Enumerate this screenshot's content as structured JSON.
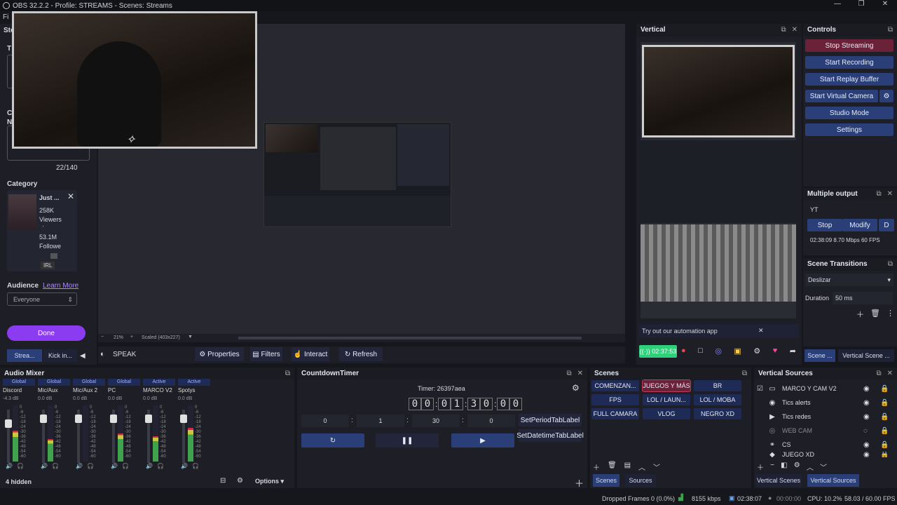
{
  "window": {
    "title": "OBS 32.2.2 - Profile: STREAMS - Scenes: Streams",
    "controls": [
      "—",
      "❐",
      "✕"
    ]
  },
  "menu": {
    "first": "Fi"
  },
  "stream_panel": {
    "title": "Ste",
    "section_t": "T",
    "section_c": "C",
    "section_n": "N",
    "char_count": "22/140",
    "category_label": "Category",
    "category": {
      "name": "Just ...",
      "viewers": "258K",
      "viewers_label": "Viewers",
      "followers": "53.1M",
      "followers_label": "Followe",
      "tag": "IRL",
      "dot": "·"
    },
    "audience_label": "Audience",
    "learn_more": "Learn More",
    "audience_value": "Everyone",
    "done": "Done",
    "tabs": [
      "Strea...",
      "Kick in..."
    ]
  },
  "preview": {
    "zoom": "21%",
    "scaled": "Scaled (403x227)",
    "zoom_minus": "−",
    "zoom_plus": "+"
  },
  "source_toolbar": {
    "source_name": "SPEAK",
    "properties": "Properties",
    "filters": "Filters",
    "interact": "Interact",
    "refresh": "Refresh"
  },
  "vertical": {
    "title": "Vertical",
    "automation_text": "Try out our automation app",
    "close_x": "✕",
    "rec_time": "02:37:53"
  },
  "controls": {
    "title": "Controls",
    "stop_streaming": "Stop Streaming",
    "start_recording": "Start Recording",
    "start_replay": "Start Replay Buffer",
    "start_virtual": "Start Virtual Camera",
    "studio_mode": "Studio Mode",
    "settings": "Settings"
  },
  "multiple_output": {
    "title": "Multiple output",
    "name": "YT",
    "stop": "Stop",
    "modify": "Modify",
    "extra": "D",
    "stats": "02:38:09  8.70 Mbps  60 FPS"
  },
  "transitions": {
    "title": "Scene Transitions",
    "selected": "Deslizar",
    "duration_label": "Duration",
    "duration_value": "50 ms"
  },
  "right_tabs": [
    "Scene ...",
    "Vertical Scene ..."
  ],
  "audio_mixer": {
    "title": "Audio Mixer",
    "hidden": "4 hidden",
    "options": "Options",
    "channels": [
      {
        "hd": "Global",
        "name": "Discord",
        "db": "-4.3 dB",
        "level": 0.55,
        "knob": 0.2
      },
      {
        "hd": "Global",
        "name": "Mic/Aux",
        "db": "0.0 dB",
        "level": 0.4,
        "knob": 0.1
      },
      {
        "hd": "Global",
        "name": "Mic/Aux 2",
        "db": "0.0 dB",
        "level": 0.0,
        "knob": 0.1
      },
      {
        "hd": "Global",
        "name": "PC",
        "db": "0.0 dB",
        "level": 0.5,
        "knob": 0.1
      },
      {
        "hd": "Active",
        "name": "MARCO V2",
        "db": "0.0 dB",
        "level": 0.45,
        "knob": 0.1
      },
      {
        "hd": "Active",
        "name": "Spotys",
        "db": "0.0 dB",
        "level": 0.6,
        "knob": 0.1
      }
    ],
    "scale": [
      "0",
      "-6",
      "-12",
      "-18",
      "-24",
      "-30",
      "-36",
      "-42",
      "-48",
      "-54",
      "-60"
    ]
  },
  "countdown": {
    "title": "CountdownTimer",
    "timer_label": "Timer: 26397aea",
    "digits": [
      "0",
      "0",
      "0",
      "1",
      "3",
      "0",
      "0",
      "0"
    ],
    "fields": [
      "0",
      "1",
      "30",
      "0"
    ],
    "sep": ":",
    "set_period": "SetPeriodTabLabel",
    "set_datetime": "SetDatetimeTabLabel"
  },
  "scenes": {
    "title": "Scenes",
    "items": [
      "COMENZAN...",
      "JUEGOS Y MÁS",
      "BR",
      "FPS",
      "LOL / LAUN...",
      "LOL / MOBA",
      "FULL CAMARA",
      "VLOG",
      "NEGRO XD"
    ],
    "active": "JUEGOS Y MÁS"
  },
  "bottom_tabs_mid": [
    "Scenes",
    "Sources"
  ],
  "vertical_sources": {
    "title": "Vertical Sources",
    "items": [
      {
        "icon": "folder",
        "label": "MARCO Y CAM V2",
        "dim": false
      },
      {
        "icon": "alert",
        "label": "Tics alerts",
        "dim": false
      },
      {
        "icon": "play",
        "label": "Tics redes",
        "dim": false
      },
      {
        "icon": "camera",
        "label": "WEB CAM",
        "dim": true
      },
      {
        "icon": "link",
        "label": "CS",
        "dim": false
      },
      {
        "icon": "game",
        "label": "JUEGO XD",
        "dim": false
      }
    ]
  },
  "bottom_tabs_right": [
    "Vertical Scenes",
    "Vertical Sources"
  ],
  "status": {
    "dropped": "Dropped Frames 0 (0.0%)",
    "bitrate": "8155 kbps",
    "stream_time": "02:38:07",
    "rec_time": "00:00:00",
    "cpu": "CPU: 10.2%",
    "fps": "58.03 / 60.00 FPS"
  },
  "colors": {
    "accent": "#2a3f77",
    "stop": "#6b2238",
    "done": "#8b3cf0",
    "green": "#2fd07a"
  }
}
